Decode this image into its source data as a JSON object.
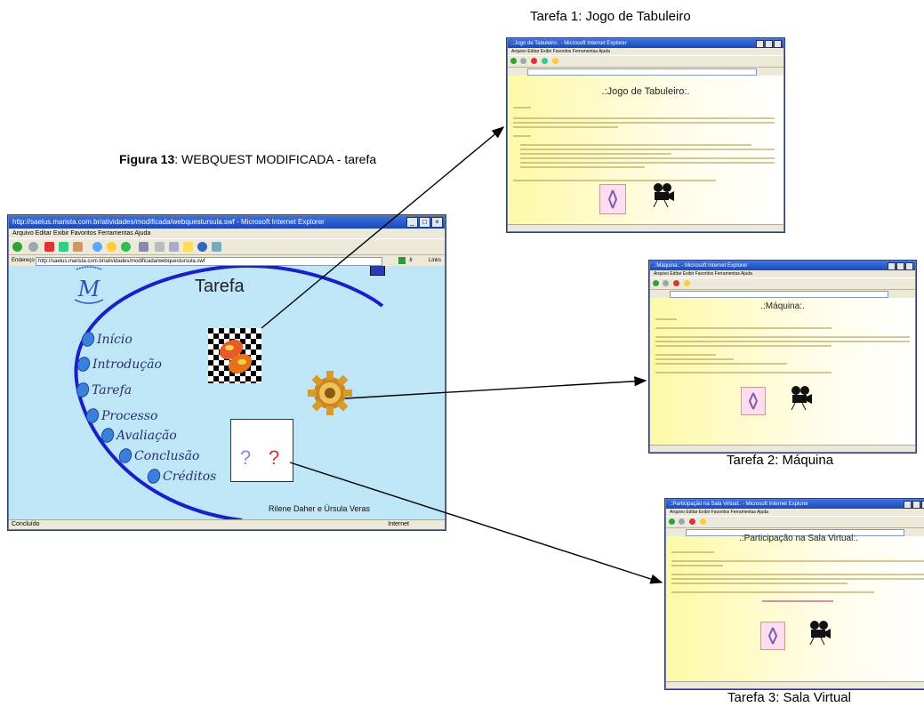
{
  "figure_caption": {
    "bold": "Figura 13",
    "rest": ": WEBQUEST MODIFICADA - tarefa"
  },
  "captions": {
    "task1": "Tarefa 1: Jogo de Tabuleiro",
    "task2": "Tarefa 2: Máquina",
    "task3": "Tarefa 3: Sala Virtual"
  },
  "main_window": {
    "title": "http://saelus.marista.com.br/atividades/modificada/webquestursula.swf - Microsoft Internet Explorer",
    "menu": "Arquivo   Editar   Exibir   Favoritos   Ferramentas   Ajuda",
    "address_label": "Endereço",
    "address": "http://saelus.marista.com.br/atividades/modificada/webquestursula.swf",
    "go_label": "Ir",
    "links_label": "Links",
    "status": "Concluído",
    "status_zone": "Internet",
    "page_title": "Tarefa",
    "nav": [
      "Início",
      "Introdução",
      "Tarefa",
      "Processo",
      "Avaliação",
      "Conclusão",
      "Créditos"
    ],
    "authors": "Rilene Daher e Úrsula Veras",
    "question_marks": [
      "?",
      "?"
    ]
  },
  "window1": {
    "title": ".:Jogo de Tabuleiro:. - Microsoft Internet Explorer",
    "heading": ".:Jogo de Tabuleiro:."
  },
  "window2": {
    "title": ".:Máquina:. - Microsoft Internet Explorer",
    "heading": ".:Máquina:."
  },
  "window3": {
    "title": ".:Participação na Sala Virtual:. - Microsoft Internet Explorer",
    "heading": ".:Participação na Sala Virtual:."
  },
  "colors": {
    "canvas_blue": "#bfe6f6",
    "arc_blue": "#1a1fc8",
    "nav_text": "#2a3170",
    "page_yellow": "#fdf9a6"
  },
  "icons": [
    "chessboard-icon",
    "gear-icon",
    "question-box-icon",
    "monogram-logo",
    "film-camera-icon",
    "figure-icon"
  ]
}
